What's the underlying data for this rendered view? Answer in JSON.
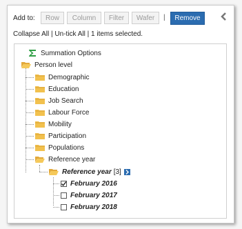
{
  "toolbar": {
    "add_to_label": "Add to:",
    "row_label": "Row",
    "column_label": "Column",
    "filter_label": "Filter",
    "wafer_label": "Wafer",
    "separator": "|",
    "remove_label": "Remove",
    "collapse_icon": "chevron-left-icon"
  },
  "actions": {
    "collapse_all": "Collapse All",
    "sep1": " | ",
    "untick_all": "Un-tick All",
    "sep2": " | ",
    "selection_status": "1 items selected."
  },
  "tree": {
    "summation": "Summation Options",
    "person_level": "Person level",
    "children": [
      "Demographic",
      "Education",
      "Job Search",
      "Labour Force",
      "Mobility",
      "Participation",
      "Populations",
      "Reference year"
    ],
    "reference_year_field": "Reference year",
    "reference_year_count": "[3]",
    "items": [
      {
        "label": "February 2016",
        "checked": true
      },
      {
        "label": "February 2017",
        "checked": false
      },
      {
        "label": "February 2018",
        "checked": false
      }
    ]
  },
  "colors": {
    "accent": "#2b6cb0",
    "folder": "#f2c14e",
    "sigma": "#2e9e44"
  }
}
